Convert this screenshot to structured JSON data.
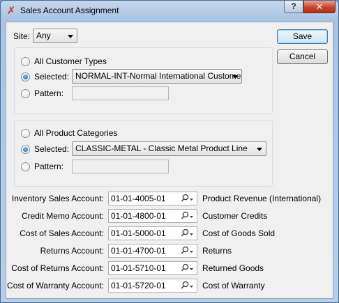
{
  "window": {
    "title": "Sales Account Assignment",
    "help_label": "?",
    "close_label": "✕"
  },
  "site": {
    "label": "Site:",
    "value": "Any"
  },
  "buttons": {
    "save": "Save",
    "cancel": "Cancel"
  },
  "customer_group": {
    "all_label": "All Customer Types",
    "selected_label": "Selected:",
    "selected_value": "NORMAL-INT-Normal International Customers",
    "pattern_label": "Pattern:",
    "pattern_value": ""
  },
  "product_group": {
    "all_label": "All Product Categories",
    "selected_label": "Selected:",
    "selected_value": "CLASSIC-METAL - Classic Metal Product Line",
    "pattern_label": "Pattern:",
    "pattern_value": ""
  },
  "accounts": [
    {
      "label": "Inventory Sales Account:",
      "value": "01-01-4005-01",
      "description": "Product Revenue (International)"
    },
    {
      "label": "Credit Memo Account:",
      "value": "01-01-4800-01",
      "description": "Customer Credits"
    },
    {
      "label": "Cost of Sales Account:",
      "value": "01-01-5000-01",
      "description": "Cost of Goods Sold"
    },
    {
      "label": "Returns Account:",
      "value": "01-01-4700-01",
      "description": "Returns"
    },
    {
      "label": "Cost of Returns Account:",
      "value": "01-01-5710-01",
      "description": "Returned Goods"
    },
    {
      "label": "Cost of Warranty Account:",
      "value": "01-01-5720-01",
      "description": "Cost of Warranty"
    }
  ]
}
